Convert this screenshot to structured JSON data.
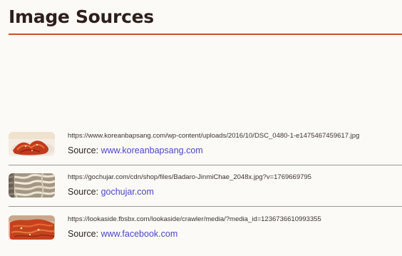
{
  "page": {
    "title": "Image Sources"
  },
  "sources": [
    {
      "url": "https://www.koreanbapsang.com/wp-content/uploads/2016/10/DSC_0480-1-e1475467459617.jpg",
      "source_label": "Source: ",
      "source_link": "www.koreanbapsang.com",
      "thumbnail_icon": "kimchi-thumbnail"
    },
    {
      "url": "https://gochujar.com/cdn/shop/files/Badaro-JinmiChae_2048x.jpg?v=1769669795",
      "source_label": "Source: ",
      "source_link": "gochujar.com",
      "thumbnail_icon": "dried-squid-thumbnail"
    },
    {
      "url": "https://lookaside.fbsbx.com/lookaside/crawler/media/?media_id=1236736610993355",
      "source_label": "Source: ",
      "source_link": "www.facebook.com",
      "thumbnail_icon": "spicy-squid-thumbnail"
    }
  ],
  "colors": {
    "accent_rule": "#c8522b",
    "link": "#4a46c8",
    "background": "#fcfaf6"
  }
}
